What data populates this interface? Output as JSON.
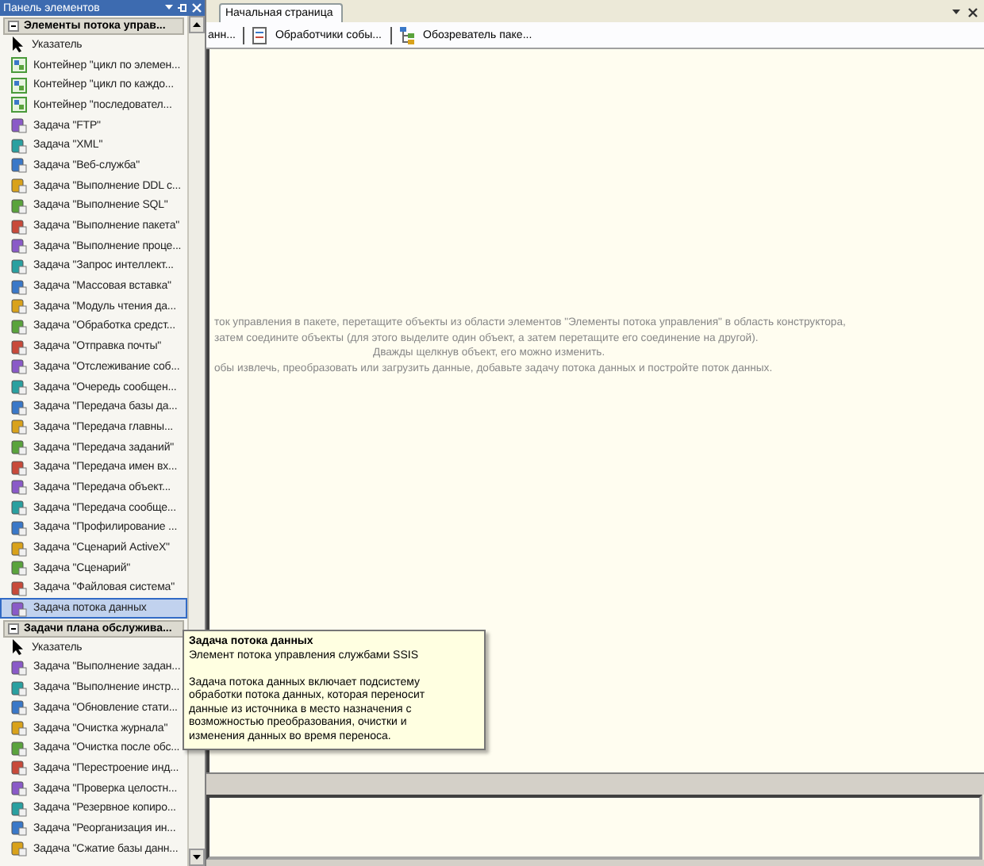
{
  "toolbox": {
    "title": "Панель элементов",
    "sections": [
      {
        "title": "Элементы потока управ...",
        "expanded": true,
        "items": [
          {
            "label": "Указатель",
            "kind": "pointer",
            "selected": false
          },
          {
            "label": "Контейнер \"цикл по элемен...",
            "kind": "container",
            "selected": false
          },
          {
            "label": "Контейнер \"цикл по каждо...",
            "kind": "container",
            "selected": false
          },
          {
            "label": "Контейнер \"последовател...",
            "kind": "container",
            "selected": false
          },
          {
            "label": "Задача \"FTP\"",
            "kind": "task",
            "selected": false
          },
          {
            "label": "Задача \"XML\"",
            "kind": "task",
            "selected": false
          },
          {
            "label": "Задача \"Веб-служба\"",
            "kind": "task",
            "selected": false
          },
          {
            "label": "Задача \"Выполнение DDL с...",
            "kind": "task",
            "selected": false
          },
          {
            "label": "Задача \"Выполнение SQL\"",
            "kind": "task",
            "selected": false
          },
          {
            "label": "Задача \"Выполнение пакета\"",
            "kind": "task",
            "selected": false
          },
          {
            "label": "Задача \"Выполнение проце...",
            "kind": "task",
            "selected": false
          },
          {
            "label": "Задача \"Запрос интеллект...",
            "kind": "task",
            "selected": false
          },
          {
            "label": "Задача \"Массовая вставка\"",
            "kind": "task",
            "selected": false
          },
          {
            "label": "Задача \"Модуль чтения да...",
            "kind": "task",
            "selected": false
          },
          {
            "label": "Задача \"Обработка средст...",
            "kind": "task",
            "selected": false
          },
          {
            "label": "Задача \"Отправка почты\"",
            "kind": "task",
            "selected": false
          },
          {
            "label": "Задача \"Отслеживание соб...",
            "kind": "task",
            "selected": false
          },
          {
            "label": "Задача \"Очередь сообщен...",
            "kind": "task",
            "selected": false
          },
          {
            "label": "Задача \"Передача базы да...",
            "kind": "task",
            "selected": false
          },
          {
            "label": "Задача \"Передача главны...",
            "kind": "task",
            "selected": false
          },
          {
            "label": "Задача \"Передача заданий\"",
            "kind": "task",
            "selected": false
          },
          {
            "label": "Задача \"Передача имен вх...",
            "kind": "task",
            "selected": false
          },
          {
            "label": "Задача \"Передача объект...",
            "kind": "task",
            "selected": false
          },
          {
            "label": "Задача \"Передача сообще...",
            "kind": "task",
            "selected": false
          },
          {
            "label": "Задача \"Профилирование ...",
            "kind": "task",
            "selected": false
          },
          {
            "label": "Задача \"Сценарий ActiveX\"",
            "kind": "task",
            "selected": false
          },
          {
            "label": "Задача \"Сценарий\"",
            "kind": "task",
            "selected": false
          },
          {
            "label": "Задача \"Файловая система\"",
            "kind": "task",
            "selected": false
          },
          {
            "label": "Задача потока данных",
            "kind": "task",
            "selected": true
          }
        ]
      },
      {
        "title": "Задачи плана обслужива...",
        "expanded": true,
        "items": [
          {
            "label": "Указатель",
            "kind": "pointer",
            "selected": false
          },
          {
            "label": "Задача \"Выполнение задан...",
            "kind": "task",
            "selected": false
          },
          {
            "label": "Задача \"Выполнение инстр...",
            "kind": "task",
            "selected": false
          },
          {
            "label": "Задача \"Обновление стати...",
            "kind": "task",
            "selected": false
          },
          {
            "label": "Задача \"Очистка журнала\"",
            "kind": "task",
            "selected": false
          },
          {
            "label": "Задача \"Очистка после обс...",
            "kind": "task",
            "selected": false
          },
          {
            "label": "Задача \"Перестроение инд...",
            "kind": "task",
            "selected": false
          },
          {
            "label": "Задача \"Проверка целостн...",
            "kind": "task",
            "selected": false
          },
          {
            "label": "Задача \"Резервное копиро...",
            "kind": "task",
            "selected": false
          },
          {
            "label": "Задача \"Реорганизация ин...",
            "kind": "task",
            "selected": false
          },
          {
            "label": "Задача \"Сжатие базы данн...",
            "kind": "task",
            "selected": false
          }
        ]
      }
    ]
  },
  "designer": {
    "tabs": [
      {
        "label": "Начальная страница",
        "selected": true
      }
    ],
    "toolbar": [
      {
        "label": "анн...",
        "kind": "plain"
      },
      {
        "label": "Обработчики собы...",
        "kind": "events"
      },
      {
        "label": "Обозреватель паке...",
        "kind": "explorer"
      }
    ],
    "hint_lines": [
      {
        "text": "ток управления в пакете, перетащите объекты из области элементов \"Элементы потока управления\" в область конструктора,",
        "kind": "left"
      },
      {
        "text": "затем соедините объекты (для этого выделите один объект, а затем перетащите его соединение на другой).",
        "kind": "left"
      },
      {
        "text": "Дважды щелкнув объект, его можно изменить.",
        "kind": "center"
      },
      {
        "text": "обы извлечь, преобразовать или загрузить данные, добавьте задачу потока данных и постройте поток данных.",
        "kind": "left"
      }
    ]
  },
  "tooltip": {
    "title": "Задача потока данных",
    "subtitle": "Элемент потока управления службами SSIS",
    "body": "Задача потока данных включает подсистему обработки потока данных, которая переносит данные из источника в место назначения с возможностью преобразования, очистки и изменения данных во время переноса."
  }
}
